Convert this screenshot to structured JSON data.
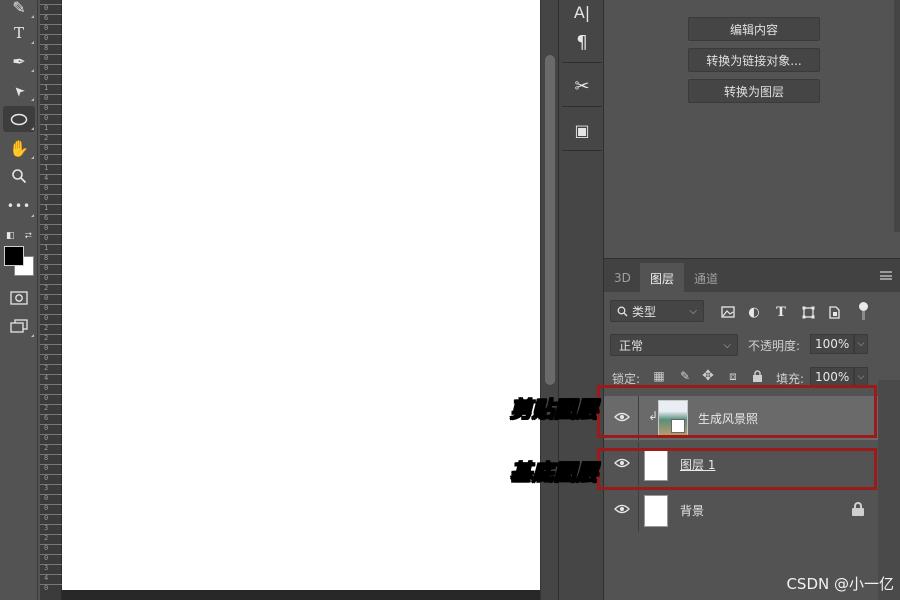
{
  "toolbar": {
    "tools": [
      {
        "name": "healing-brush-icon",
        "glyph": "✎"
      },
      {
        "name": "vertical-type-icon",
        "glyph": "T"
      },
      {
        "name": "pen-icon",
        "glyph": "✒"
      },
      {
        "name": "path-selection-icon",
        "glyph": "➤"
      },
      {
        "name": "ellipse-tool-icon",
        "glyph": "◯"
      },
      {
        "name": "hand-tool-icon",
        "glyph": "✋"
      },
      {
        "name": "zoom-icon",
        "glyph": "🔍"
      },
      {
        "name": "more-tools-icon",
        "glyph": "•••"
      }
    ],
    "active_tool": "ellipse-tool-icon",
    "foreground_color": "#000000",
    "background_color": "#ffffff"
  },
  "ruler": {
    "ticks": [
      "0",
      "6",
      "0",
      "0",
      "8",
      "0",
      "0",
      "0",
      "1",
      "0",
      "0",
      "0",
      "1",
      "2",
      "0",
      "0",
      "1",
      "4",
      "0",
      "0",
      "1",
      "6",
      "0",
      "0",
      "1",
      "8",
      "0",
      "0",
      "2",
      "0",
      "0",
      "0",
      "2",
      "2",
      "0",
      "0",
      "2",
      "4",
      "0",
      "0",
      "2",
      "6",
      "0",
      "0",
      "2",
      "8",
      "0",
      "0",
      "3",
      "0",
      "0",
      "0",
      "3",
      "2",
      "0",
      "0",
      "3",
      "4",
      "0"
    ]
  },
  "icon_column": {
    "top_buttons": [
      {
        "name": "character-icon",
        "glyph": "A|"
      },
      {
        "name": "paragraph-icon",
        "glyph": "¶"
      }
    ],
    "mid_buttons": [
      {
        "name": "tool-presets-icon",
        "glyph": "✂"
      },
      {
        "name": "clone-source-icon",
        "glyph": "▣"
      }
    ]
  },
  "properties": {
    "buttons": [
      "编辑内容",
      "转换为链接对象...",
      "转换为图层"
    ]
  },
  "layers_panel": {
    "tabs": [
      "3D",
      "图层",
      "通道"
    ],
    "active_tab": "图层",
    "filter_label": "类型",
    "filter_icons": [
      {
        "name": "image-filter-icon",
        "glyph": "▣"
      },
      {
        "name": "adjustment-filter-icon",
        "glyph": "◐"
      },
      {
        "name": "type-filter-icon",
        "glyph": "T"
      },
      {
        "name": "shape-filter-icon",
        "glyph": "⬚"
      },
      {
        "name": "smart-object-filter-icon",
        "glyph": "⧉"
      }
    ],
    "blend_mode": "正常",
    "opacity_label": "不透明度:",
    "opacity_value": "100%",
    "lock_label": "锁定:",
    "fill_label": "填充:",
    "fill_value": "100%",
    "lock_icons": [
      {
        "name": "lock-transparent-icon",
        "glyph": "▦"
      },
      {
        "name": "lock-paint-icon",
        "glyph": "✎"
      },
      {
        "name": "lock-position-icon",
        "glyph": "✥"
      },
      {
        "name": "lock-artboard-icon",
        "glyph": "⧈"
      },
      {
        "name": "lock-all-icon",
        "glyph": "🔒"
      }
    ],
    "layers": [
      {
        "name": "生成风景照",
        "type": "clipped-smart-object",
        "selected": true
      },
      {
        "name": "图层 1",
        "type": "pixel",
        "selected": false
      },
      {
        "name": "背景",
        "type": "background",
        "selected": false,
        "locked": true
      }
    ]
  },
  "annotations": {
    "clip_layer_label": "剪贴图层",
    "base_layer_label": "基底图层",
    "box_color": "#9b1b1b",
    "label_color": "#f3f08a"
  },
  "watermark": "CSDN @小一亿"
}
